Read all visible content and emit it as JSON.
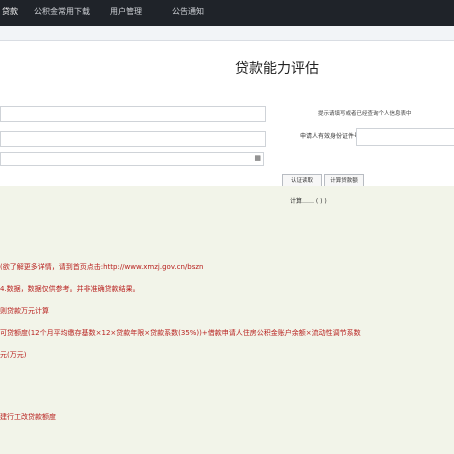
{
  "nav": {
    "items": [
      "贷款",
      "公积金常用下载",
      "用户管理",
      "公告通知"
    ]
  },
  "page": {
    "title": "贷款能力评估"
  },
  "form": {
    "note": "提示请填写或者已经查询个人信息表中",
    "applicant_label": "申请人有效身份证件号码：",
    "select_icon": "calendar-icon"
  },
  "tabs": [
    "认证读取",
    "计算贷款额"
  ],
  "result": {
    "hint": "计算…… ( ) )"
  },
  "lines": [
    "(欲了解更多详情，请到首页点击:http://www.xmzj.gov.cn/bszn",
    "4.数据，数据仅供参考。并非准确贷款结果。",
    "则贷款万元计算",
    "可贷额度(12个月平均缴存基数×12×贷款年限×贷款系数(35%))+借款申请人住房公积金账户余额×流动性调节系数",
    "元(万元)",
    "建行工改贷款额度"
  ],
  "colors": {
    "topbar": "#1f2329",
    "panel": "#f2f4e9",
    "accent_red": "#b8201e"
  }
}
